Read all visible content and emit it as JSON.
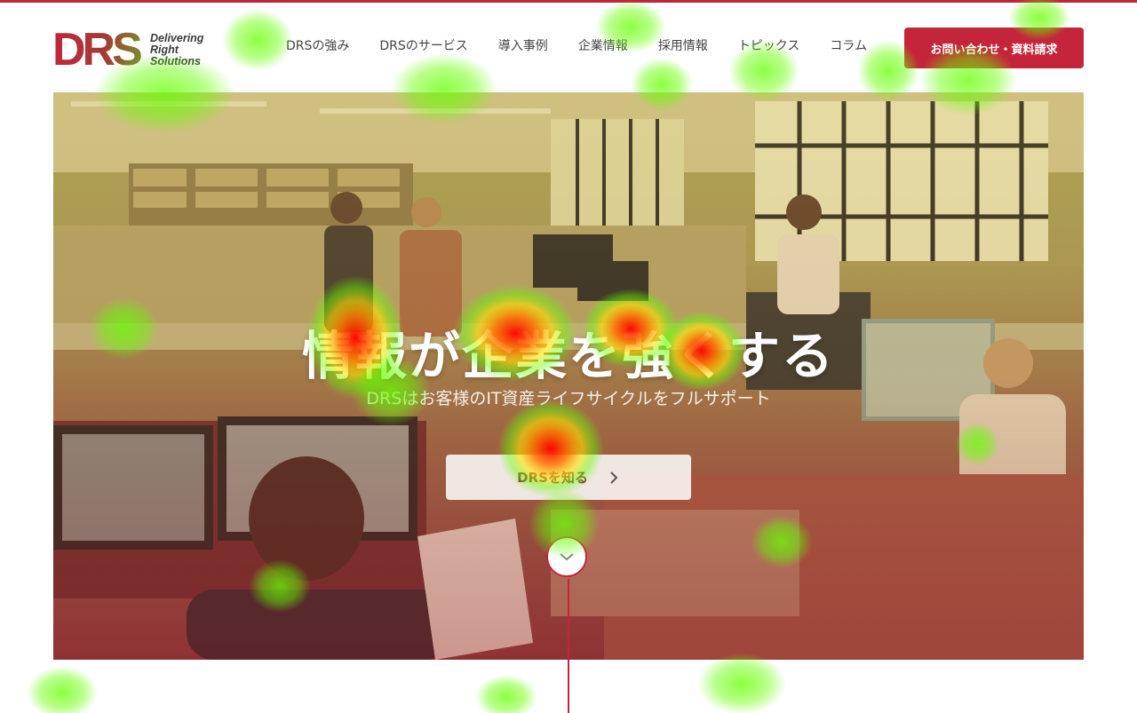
{
  "header": {
    "logo_text": "DRS",
    "tagline": [
      "Delivering",
      "Right",
      "Solutions"
    ],
    "nav": [
      {
        "label": "DRSの強み"
      },
      {
        "label": "DRSのサービス"
      },
      {
        "label": "導入事例"
      },
      {
        "label": "企業情報"
      },
      {
        "label": "採用情報"
      },
      {
        "label": "トピックス"
      },
      {
        "label": "コラム"
      }
    ],
    "cta_label": "お問い合わせ・資料請求"
  },
  "hero": {
    "title": "情報が企業を強くする",
    "subtitle": "DRSはお客様のIT資産ライフサイクルをフルサポート",
    "button_label": "DRSを知る",
    "button_icon": "chevron-right-icon",
    "scroll_icon": "chevron-down-icon"
  },
  "colors": {
    "brand_red": "#c5253a",
    "brand_olive": "#7a8a2a"
  }
}
